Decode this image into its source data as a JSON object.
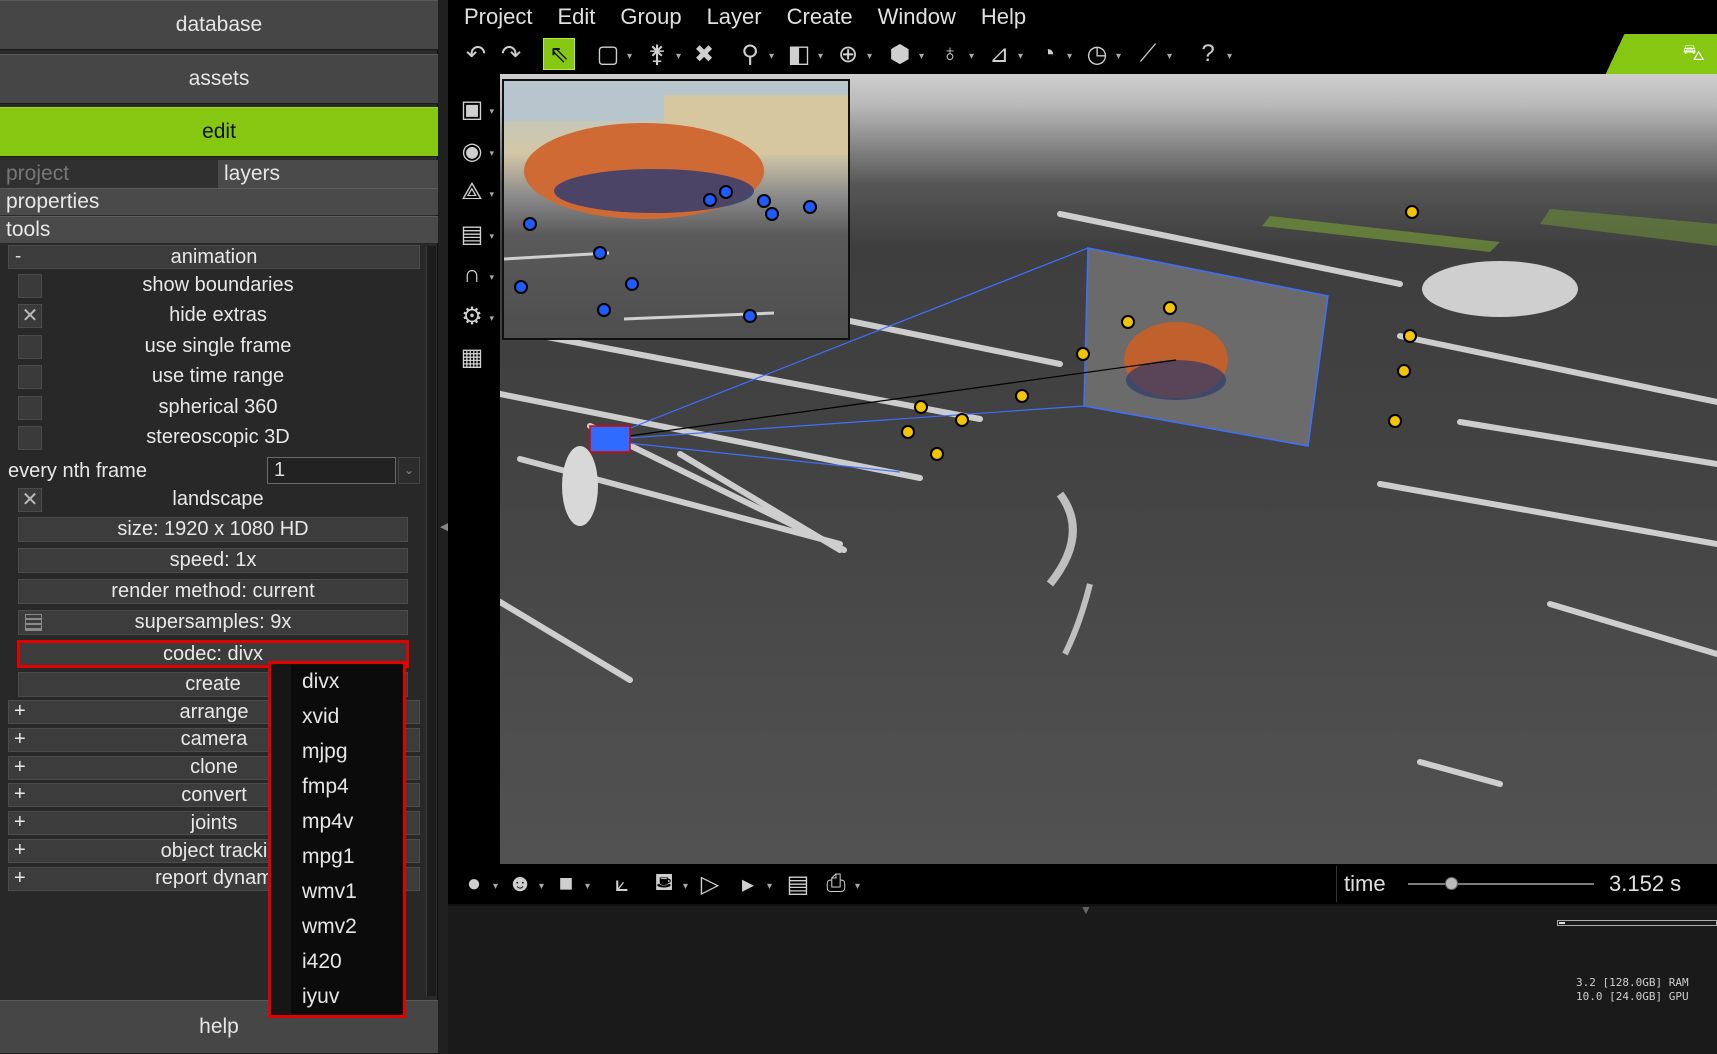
{
  "nav": {
    "database": "database",
    "assets": "assets",
    "edit": "edit",
    "help": "help"
  },
  "subtabs": {
    "project": "project",
    "layers": "layers"
  },
  "sections": {
    "properties": "properties",
    "tools": "tools"
  },
  "animation": {
    "header": "animation",
    "toggle": "-",
    "options": [
      {
        "label": "show boundaries",
        "checked": false
      },
      {
        "label": "hide extras",
        "checked": true
      },
      {
        "label": "use single frame",
        "checked": false
      },
      {
        "label": "use time range",
        "checked": false
      },
      {
        "label": "spherical 360",
        "checked": false
      },
      {
        "label": "stereoscopic 3D",
        "checked": false
      }
    ],
    "nth_frame_label": "every nth frame",
    "nth_frame_value": "1",
    "landscape_label": "landscape",
    "landscape_checked": true,
    "size_label": "size: 1920 x 1080 HD",
    "speed_label": "speed: 1x",
    "render_label": "render method: current",
    "supersamples_label": "supersamples: 9x",
    "codec_label": "codec: divx",
    "create_label": "create"
  },
  "collapsed_groups": [
    {
      "toggle": "+",
      "label": "arrange"
    },
    {
      "toggle": "+",
      "label": "camera"
    },
    {
      "toggle": "+",
      "label": "clone"
    },
    {
      "toggle": "+",
      "label": "convert"
    },
    {
      "toggle": "+",
      "label": "joints"
    },
    {
      "toggle": "+",
      "label": "object tracki"
    },
    {
      "toggle": "+",
      "label": "report dynam"
    }
  ],
  "codec_options": [
    "divx",
    "xvid",
    "mjpg",
    "fmp4",
    "mp4v",
    "mpg1",
    "wmv1",
    "wmv2",
    "i420",
    "iyuv"
  ],
  "menu": [
    "Project",
    "Edit",
    "Group",
    "Layer",
    "Create",
    "Window",
    "Help"
  ],
  "toolbar_icons": [
    "undo-icon",
    "redo-icon",
    "select-arrow-icon",
    "box-select-icon",
    "pin-icon",
    "delete-x-icon",
    "zoom-icon",
    "cube-icon",
    "move-icon",
    "box-icon",
    "light-bulb-icon",
    "measure-icon",
    "gauge-icon",
    "stopwatch-icon",
    "wand-icon",
    "help-icon"
  ],
  "left_tools_icons": [
    "camera-icon",
    "target-icon",
    "axis-icon",
    "film-icon",
    "magnet-icon",
    "gear-icon",
    "grid-icon"
  ],
  "bottom_icons": [
    "sphere-icon",
    "head-icon",
    "square-icon",
    "graph-icon",
    "teapot-icon",
    "play-icon",
    "sequence-icon",
    "sheet-icon",
    "printer-icon"
  ],
  "time": {
    "label": "time",
    "value": "3.152 s",
    "fraction": 0.23
  },
  "stats": {
    "ram": "3.2 [128.0GB] RAM",
    "gpu": "10.0 [24.0GB] GPU"
  },
  "colors": {
    "accent": "#86c811",
    "highlight": "#e30000",
    "marker_yellow": "#f4c400",
    "marker_blue": "#1e5cff"
  }
}
